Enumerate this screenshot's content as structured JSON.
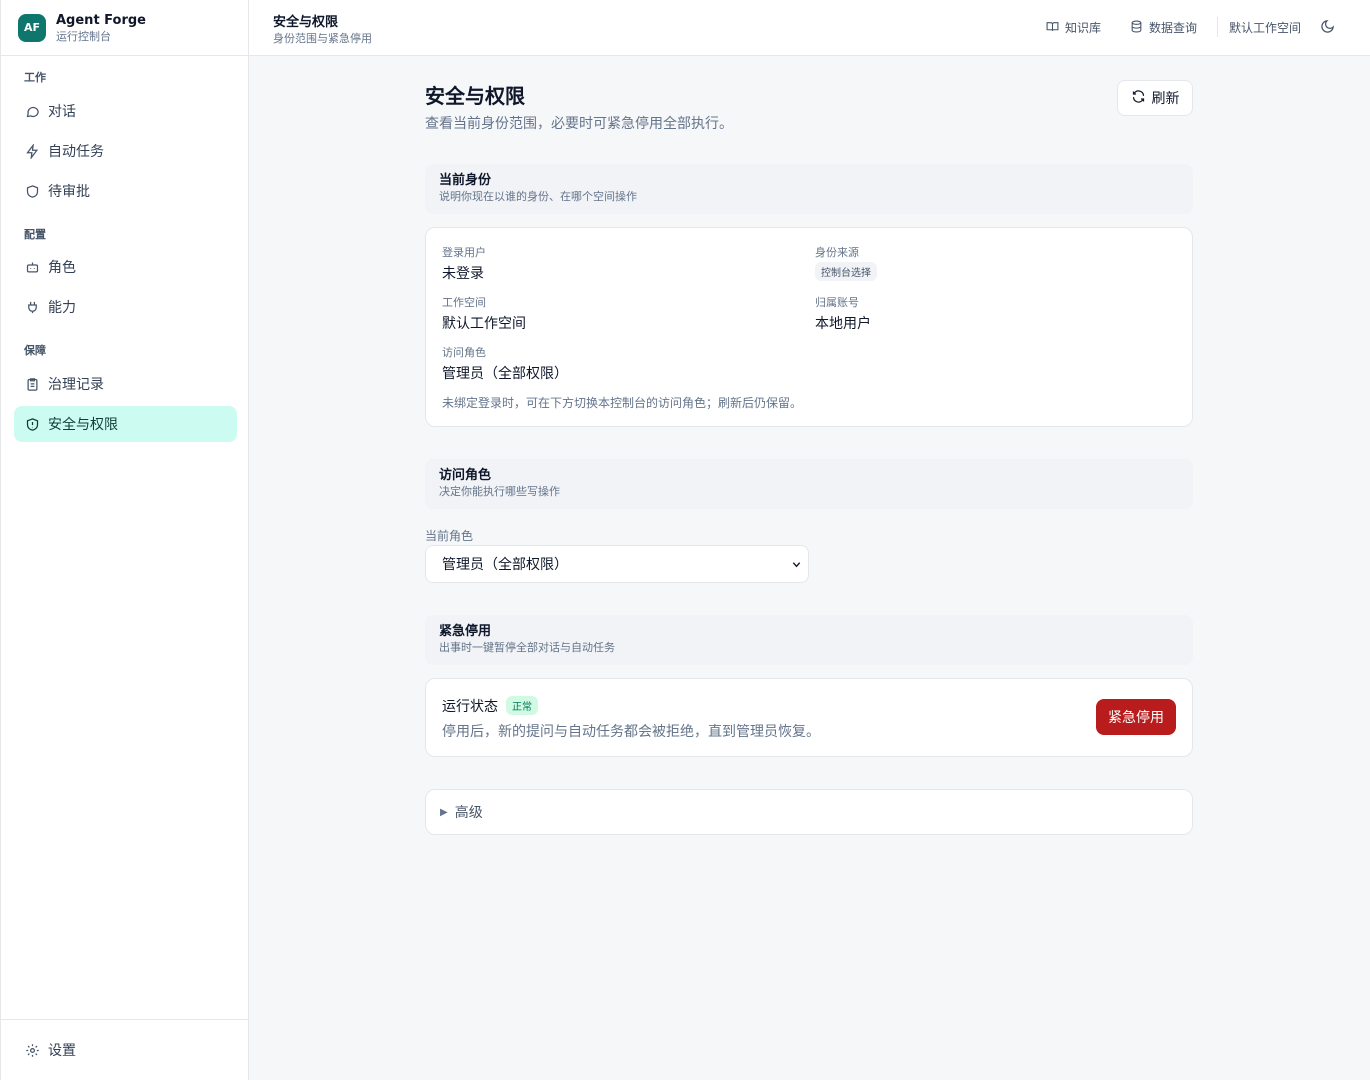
{
  "brand": {
    "logo": "AF",
    "name": "Agent Forge",
    "subtitle": "运行控制台"
  },
  "sidebar": {
    "sections": [
      {
        "label": "工作"
      },
      {
        "label": "配置"
      },
      {
        "label": "保障"
      }
    ],
    "items": [
      {
        "label": "对话",
        "icon": "chat-bubble-icon"
      },
      {
        "label": "自动任务",
        "icon": "lightning-icon"
      },
      {
        "label": "待审批",
        "icon": "shield-icon"
      },
      {
        "label": "角色",
        "icon": "bot-icon"
      },
      {
        "label": "能力",
        "icon": "plug-icon"
      },
      {
        "label": "治理记录",
        "icon": "clipboard-icon"
      },
      {
        "label": "安全与权限",
        "icon": "shield-alert-icon",
        "active": true
      }
    ],
    "footer": {
      "label": "设置",
      "icon": "gear-icon"
    }
  },
  "header": {
    "title": "安全与权限",
    "subtitle": "身份范围与紧急停用",
    "links": [
      {
        "label": "知识库",
        "icon": "book-icon"
      },
      {
        "label": "数据查询",
        "icon": "database-icon"
      }
    ],
    "workspace": "默认工作空间",
    "theme_icon": "moon-icon"
  },
  "page": {
    "title": "安全与权限",
    "subtitle": "查看当前身份范围，必要时可紧急停用全部执行。",
    "refresh_label": "刷新"
  },
  "identity": {
    "title": "当前身份",
    "subtitle": "说明你现在以谁的身份、在哪个空间操作",
    "fields": {
      "login_user_label": "登录用户",
      "login_user_value": "未登录",
      "source_label": "身份来源",
      "source_value": "控制台选择",
      "workspace_label": "工作空间",
      "workspace_value": "默认工作空间",
      "account_label": "归属账号",
      "account_value": "本地用户",
      "role_label": "访问角色",
      "role_value": "管理员（全部权限）"
    },
    "note": "未绑定登录时，可在下方切换本控制台的访问角色；刷新后仍保留。"
  },
  "access_role": {
    "title": "访问角色",
    "subtitle": "决定你能执行哪些写操作",
    "select_label": "当前角色",
    "select_value": "管理员（全部权限）"
  },
  "emergency": {
    "title": "紧急停用",
    "subtitle": "出事时一键暂停全部对话与自动任务",
    "status_label": "运行状态",
    "status_badge": "正常",
    "description": "停用后，新的提问与自动任务都会被拒绝，直到管理员恢复。",
    "button_label": "紧急停用",
    "button_color": "#b91c1c"
  },
  "advanced": {
    "label": "高级"
  },
  "colors": {
    "accent": "#0f766e",
    "active_bg": "#ccfbf1",
    "ok_badge": "#d1fae5"
  }
}
